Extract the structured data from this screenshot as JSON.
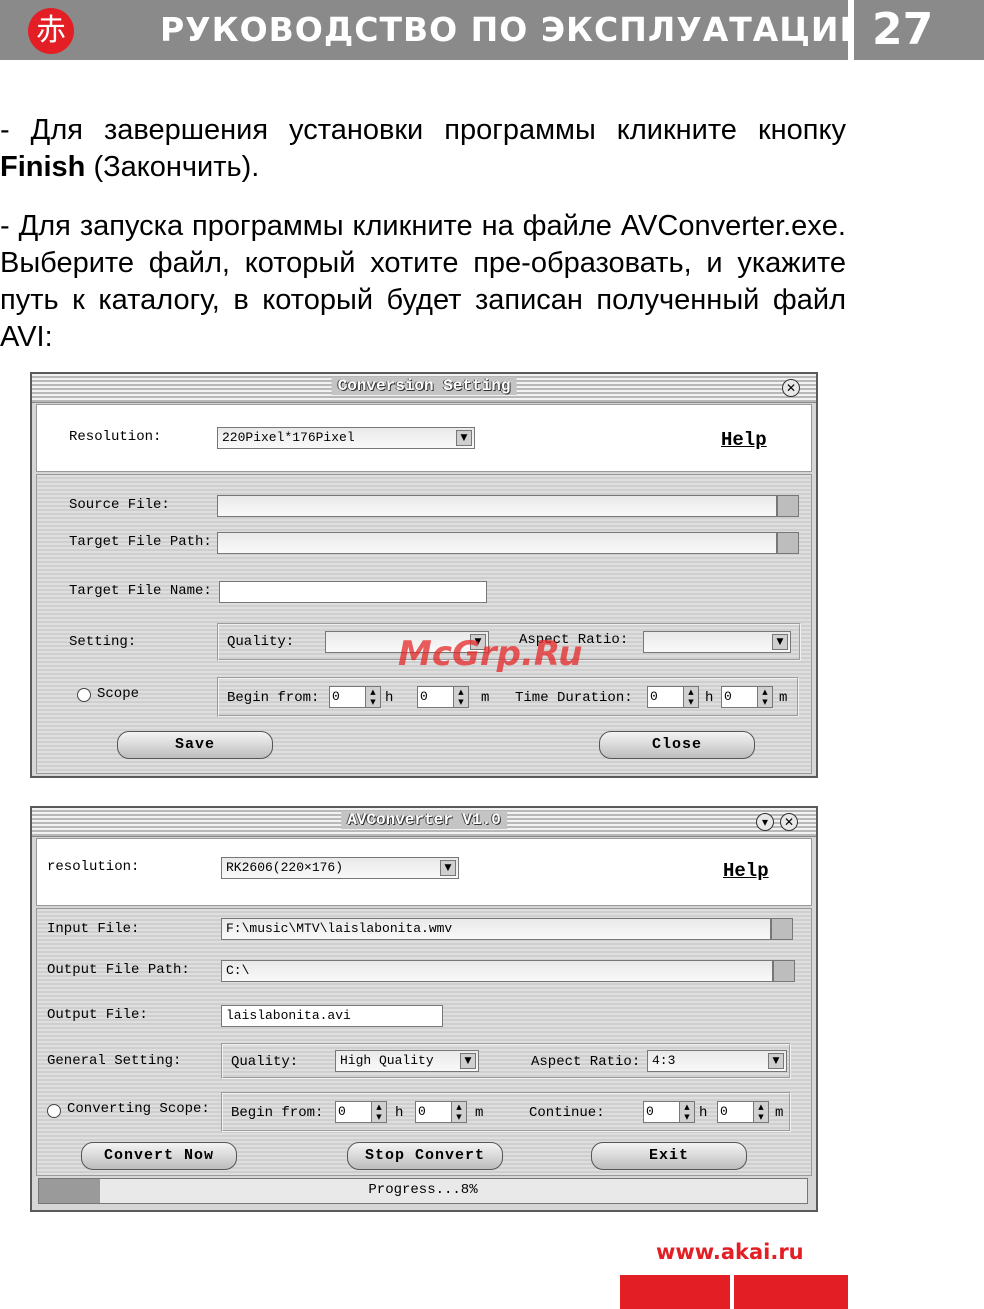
{
  "header": {
    "title": "РУКОВОДСТВО ПО ЭКСПЛУАТАЦИИ",
    "page_number": "27",
    "logo_glyph": "赤"
  },
  "paragraphs": {
    "p1_a": "-   Для завершения установки программы кликните кнопку ",
    "p1_bold": "Finish",
    "p1_b": " (Закончить).",
    "p2": "-   Для запуска программы кликните на файле AVConverter.exe. Выберите файл, который хотите пре-образовать, и укажите путь к каталогу, в который будет записан полученный файл AVI:"
  },
  "watermark": "McGrp.Ru",
  "conversion_setting": {
    "title": "Conversion Setting",
    "close_glyph": "✕",
    "resolution_label": "Resolution:",
    "resolution_value": "220Pixel*176Pixel",
    "help": "Help",
    "source_file_label": "Source File:",
    "target_path_label": "Target File Path:",
    "target_name_label": "Target File Name:",
    "setting_label": "Setting:",
    "quality_label": "Quality:",
    "aspect_label": "Aspect Ratio:",
    "scope_label": "Scope",
    "begin_label": "Begin from:",
    "duration_label": "Time Duration:",
    "spin_value": "0",
    "h": "h",
    "m": "m",
    "save": "Save",
    "close": "Close"
  },
  "avconverter": {
    "title": "AVConverter V1.0",
    "min_glyph": "▾",
    "close_glyph": "✕",
    "resolution_label": "resolution:",
    "resolution_value": "RK2606(220×176)",
    "help": "Help",
    "input_label": "Input File:",
    "input_value": "F:\\music\\MTV\\laislabonita.wmv",
    "output_path_label": "Output File Path:",
    "output_path_value": "C:\\",
    "output_file_label": "Output File:",
    "output_file_value": "laislabonita.avi",
    "general_label": "General Setting:",
    "quality_label": "Quality:",
    "quality_value": "High Quality",
    "aspect_label": "Aspect Ratio:",
    "aspect_value": "4:3",
    "scope_label": "Converting Scope:",
    "begin_label": "Begin from:",
    "continue_label": "Continue:",
    "spin_value": "0",
    "h": "h",
    "m": "m",
    "convert_now": "Convert Now",
    "stop_convert": "Stop Convert",
    "exit": "Exit",
    "progress_text": "Progress...8%",
    "progress_fraction": 0.08
  },
  "footer": {
    "url": "www.akai.ru"
  },
  "colors": {
    "brand_red": "#e31e24",
    "header_grey": "#8a8a8a"
  }
}
